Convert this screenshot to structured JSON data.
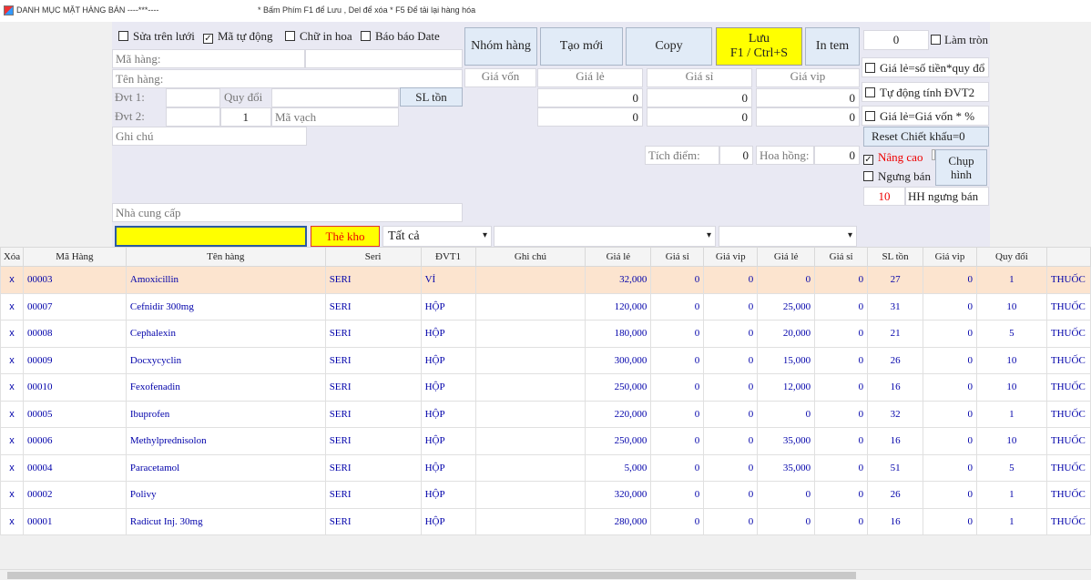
{
  "window": {
    "title": "DANH MỤC MẶT HÀNG BÁN ----***----",
    "hint": "* Bấm Phím  F1 để Lưu ,  Del để xóa  *     F5 Để tải lại hàng hóa"
  },
  "options": {
    "edit_on_grid": "Sửa trên lưới",
    "auto_code": "Mã tự động",
    "uppercase": "Chữ in hoa",
    "report_date": "Báo báo Date",
    "edit_on_grid_checked": false,
    "auto_code_checked": true,
    "uppercase_checked": false,
    "report_date_checked": false
  },
  "form": {
    "ma_hang_label": "Mã hàng:",
    "ten_hang_label": "Tên hàng:",
    "dvt1_label": "Đvt 1:",
    "quy_doi_label": "Quy đổi",
    "sl_ton_label": "SL tồn",
    "dvt2_label": "Đvt 2:",
    "dvt2_factor": "1",
    "ma_vach_label": "Mã vạch",
    "ghi_chu_label": "Ghi chú",
    "nha_cung_cap_label": "Nhà cung cấp"
  },
  "buttons": {
    "nhom_hang": "Nhóm hàng",
    "tao_moi": "Tạo mới",
    "copy": "Copy",
    "luu_line1": "Lưu",
    "luu_line2": "F1 / Ctrl+S",
    "in_tem": "In tem",
    "reset": "Reset Chiết khấu=0",
    "chup_hinh_line1": "Chụp",
    "chup_hinh_line2": "hình",
    "the_kho": "Thẻ kho"
  },
  "prices": {
    "gia_von": "Giá vốn",
    "gia_le": "Giá lẻ",
    "gia_si": "Giá sỉ",
    "gia_vip": "Giá vip",
    "row1": [
      "0",
      "0",
      "0"
    ],
    "row2": [
      "0",
      "0",
      "0"
    ],
    "tich_diem_label": "Tích điểm:",
    "tich_diem_value": "0",
    "hoa_hong_label": "Hoa hồng:",
    "hoa_hong_value": "0"
  },
  "right_panel": {
    "round_value": "0",
    "lam_tron": "Làm tròn",
    "gia_le_so_tien": "Giá lẻ=số tiền*quy đổ",
    "tu_dong_dvt2": "Tự động tính ĐVT2",
    "gia_le_gia_von": "Giá lẻ=Giá vốn * %",
    "nang_cao": "Nâng cao",
    "nang_cao_checked": true,
    "ngung_ban": "Ngưng bán",
    "ngung_ban_count": "10",
    "hh_ngung_ban": "HH ngưng bán"
  },
  "filters": {
    "category": "Tất cả"
  },
  "grid": {
    "headers": [
      "Xóa",
      "Mã Hàng",
      "Tên hàng",
      "Seri",
      "ĐVT1",
      "Ghi chú",
      "Giá lẻ",
      "Giá sỉ",
      "Giá vip",
      "Giá lẻ",
      "Giá sỉ",
      "SL tồn",
      "Giá vip",
      "Quy đổi",
      ""
    ],
    "delete_label": "x",
    "rows": [
      {
        "code": "00003",
        "name": "Amoxicillin",
        "seri": "SERI",
        "dvt1": "VỈ",
        "note": "",
        "gia_le": "32,000",
        "gia_si": "0",
        "gia_vip": "0",
        "gia_le2": "0",
        "gia_si2": "0",
        "sl_ton": "27",
        "gia_vip2": "0",
        "quy_doi": "1",
        "group": "THUỐC"
      },
      {
        "code": "00007",
        "name": "Cefnidir 300mg",
        "seri": "SERI",
        "dvt1": "HỘP",
        "note": "",
        "gia_le": "120,000",
        "gia_si": "0",
        "gia_vip": "0",
        "gia_le2": "25,000",
        "gia_si2": "0",
        "sl_ton": "31",
        "gia_vip2": "0",
        "quy_doi": "10",
        "group": "THUỐC"
      },
      {
        "code": "00008",
        "name": "Cephalexin",
        "seri": "SERI",
        "dvt1": "HỘP",
        "note": "",
        "gia_le": "180,000",
        "gia_si": "0",
        "gia_vip": "0",
        "gia_le2": "20,000",
        "gia_si2": "0",
        "sl_ton": "21",
        "gia_vip2": "0",
        "quy_doi": "5",
        "group": "THUỐC"
      },
      {
        "code": "00009",
        "name": "Docxycyclin",
        "seri": "SERI",
        "dvt1": "HỘP",
        "note": "",
        "gia_le": "300,000",
        "gia_si": "0",
        "gia_vip": "0",
        "gia_le2": "15,000",
        "gia_si2": "0",
        "sl_ton": "26",
        "gia_vip2": "0",
        "quy_doi": "10",
        "group": "THUỐC"
      },
      {
        "code": "00010",
        "name": "Fexofenadin",
        "seri": "SERI",
        "dvt1": "HỘP",
        "note": "",
        "gia_le": "250,000",
        "gia_si": "0",
        "gia_vip": "0",
        "gia_le2": "12,000",
        "gia_si2": "0",
        "sl_ton": "16",
        "gia_vip2": "0",
        "quy_doi": "10",
        "group": "THUỐC"
      },
      {
        "code": "00005",
        "name": "Ibuprofen",
        "seri": "SERI",
        "dvt1": "HỘP",
        "note": "",
        "gia_le": "220,000",
        "gia_si": "0",
        "gia_vip": "0",
        "gia_le2": "0",
        "gia_si2": "0",
        "sl_ton": "32",
        "gia_vip2": "0",
        "quy_doi": "1",
        "group": "THUỐC"
      },
      {
        "code": "00006",
        "name": "Methylprednisolon",
        "seri": "SERI",
        "dvt1": "HỘP",
        "note": "",
        "gia_le": "250,000",
        "gia_si": "0",
        "gia_vip": "0",
        "gia_le2": "35,000",
        "gia_si2": "0",
        "sl_ton": "16",
        "gia_vip2": "0",
        "quy_doi": "10",
        "group": "THUỐC"
      },
      {
        "code": "00004",
        "name": "Paracetamol",
        "seri": "SERI",
        "dvt1": "HỘP",
        "note": "",
        "gia_le": "5,000",
        "gia_si": "0",
        "gia_vip": "0",
        "gia_le2": "35,000",
        "gia_si2": "0",
        "sl_ton": "51",
        "gia_vip2": "0",
        "quy_doi": "5",
        "group": "THUỐC"
      },
      {
        "code": "00002",
        "name": "Polivy",
        "seri": "SERI",
        "dvt1": "HỘP",
        "note": "",
        "gia_le": "320,000",
        "gia_si": "0",
        "gia_vip": "0",
        "gia_le2": "0",
        "gia_si2": "0",
        "sl_ton": "26",
        "gia_vip2": "0",
        "quy_doi": "1",
        "group": "THUỐC"
      },
      {
        "code": "00001",
        "name": "Radicut Inj. 30mg",
        "seri": "SERI",
        "dvt1": "HỘP",
        "note": "",
        "gia_le": "280,000",
        "gia_si": "0",
        "gia_vip": "0",
        "gia_le2": "0",
        "gia_si2": "0",
        "sl_ton": "16",
        "gia_vip2": "0",
        "quy_doi": "1",
        "group": "THUỐC"
      }
    ]
  }
}
